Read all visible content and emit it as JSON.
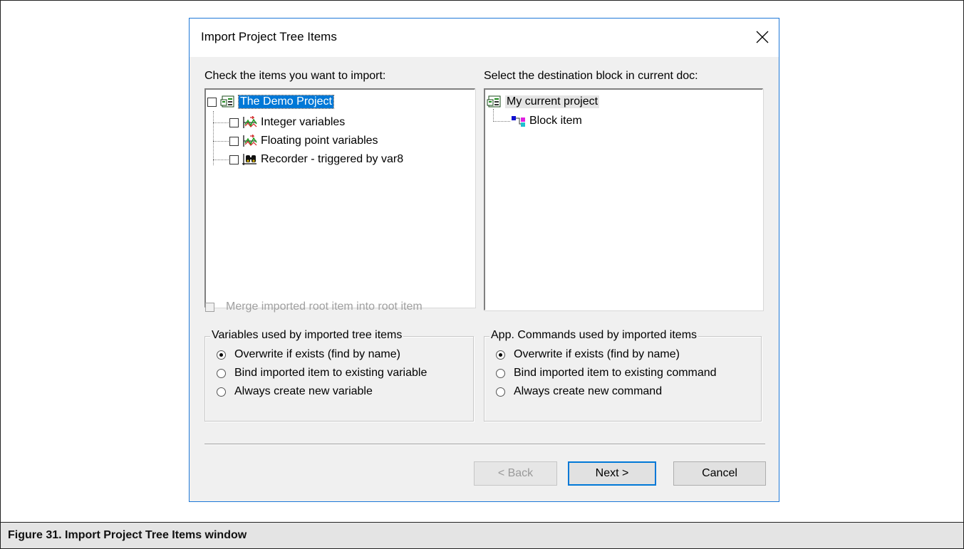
{
  "dialog": {
    "title": "Import Project Tree Items",
    "left_label": "Check the items you want to import:",
    "right_label": "Select the destination block in current doc:",
    "source_tree": {
      "root": "The Demo Project",
      "children": [
        "Integer variables",
        "Floating point variables",
        "Recorder - triggered by var8"
      ]
    },
    "dest_tree": {
      "root": "My current project",
      "children": [
        "Block item"
      ]
    },
    "merge_checkbox": "Merge imported root item into root item",
    "vars_group": {
      "title": "Variables used by imported tree items",
      "options": [
        "Overwrite if exists (find by name)",
        "Bind imported item to existing variable",
        "Always create new variable"
      ],
      "selected": 0
    },
    "cmds_group": {
      "title": "App. Commands used by imported items",
      "options": [
        "Overwrite if exists (find by name)",
        "Bind imported item to existing command",
        "Always create new command"
      ],
      "selected": 0
    },
    "buttons": {
      "back": "< Back",
      "next": "Next >",
      "cancel": "Cancel"
    }
  },
  "caption": "Figure 31. Import Project Tree Items window",
  "colors": {
    "selection": "#0078d7",
    "dialog_border": "#1e78d8",
    "face": "#f0f0f0"
  }
}
